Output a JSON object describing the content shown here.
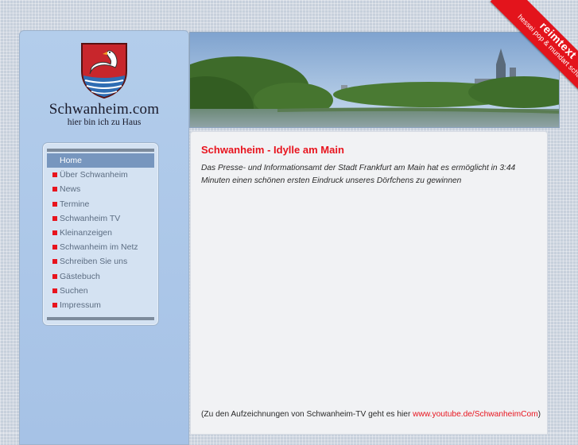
{
  "logo": {
    "title": "Schwanheim.com",
    "subtitle": "hier bin ich zu Haus"
  },
  "nav": {
    "items": [
      {
        "label": "Home",
        "active": true
      },
      {
        "label": "Über Schwanheim"
      },
      {
        "label": "News"
      },
      {
        "label": "Termine"
      },
      {
        "label": "Schwanheim TV"
      },
      {
        "label": "Kleinanzeigen"
      },
      {
        "label": "Schwanheim im Netz"
      },
      {
        "label": "Schreiben Sie uns"
      },
      {
        "label": "Gästebuch"
      },
      {
        "label": "Suchen"
      },
      {
        "label": "Impressum"
      }
    ]
  },
  "main": {
    "title": "Schwanheim - Idylle am Main",
    "intro": "Das Presse- und Informationsamt der Stadt Frankfurt am Main hat es ermöglicht in 3:44 Minuten einen schönen ersten Eindruck unseres Dörfchens zu gewinnen",
    "footer_prefix": "(Zu den Aufzeichnungen von Schwanheim-TV geht es hier ",
    "footer_link": "www.youtube.de/SchwanheimCom",
    "footer_suffix": ")"
  },
  "ribbon": {
    "title": "reimtext",
    "subtitle": "hessei pop & mundart schau"
  },
  "colors": {
    "accent_red": "#e8141e",
    "sidebar_blue": "#a6c2e6",
    "nav_active": "#7796be"
  }
}
